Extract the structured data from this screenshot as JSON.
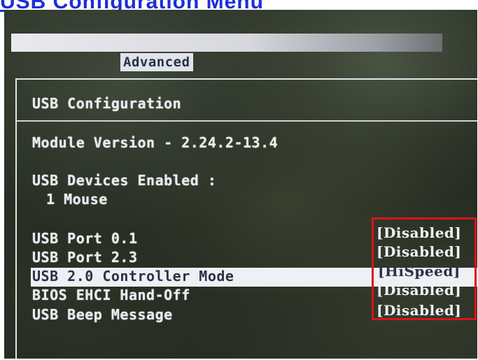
{
  "page_title": "USB Configuration Menu",
  "tabs": {
    "active": "Advanced"
  },
  "section": {
    "title": "USB Configuration",
    "module_version": "Module Version - 2.24.2-13.4",
    "devices_enabled_label": "USB Devices Enabled :",
    "devices_enabled_value": "1 Mouse"
  },
  "settings": [
    {
      "label": "USB Port 0.1",
      "value": "[Disabled]"
    },
    {
      "label": "USB Port 2.3",
      "value": "[Disabled]"
    },
    {
      "label": "USB 2.0 Controller Mode",
      "value": "[HiSpeed]",
      "selected": true
    },
    {
      "label": "BIOS EHCI Hand-Off",
      "value": "[Disabled]"
    },
    {
      "label": "USB Beep Message",
      "value": "[Disabled]"
    }
  ],
  "colors": {
    "title_link": "#1a2fd6",
    "highlight_box": "#d8141a",
    "selection_bar": "#eef0f3"
  }
}
